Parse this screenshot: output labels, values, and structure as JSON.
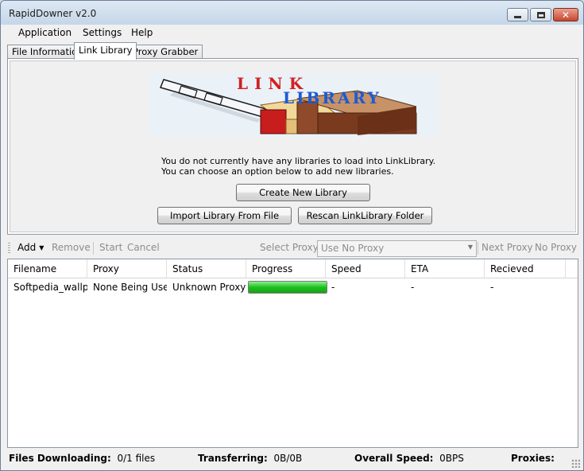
{
  "window": {
    "title": "RapidDowner v2.0"
  },
  "menu": {
    "items": [
      "Application",
      "Settings",
      "Help"
    ]
  },
  "tabs": [
    "File Information",
    "Link Library",
    "Proxy Grabber"
  ],
  "link_library": {
    "logo_text_1": "LINK",
    "logo_text_2": "LIBRARY",
    "message": "You do not currently have any libraries to load into LinkLibrary. You can choose an option below to add new libraries.",
    "create_button": "Create New Library",
    "import_button": "Import Library From File",
    "rescan_button": "Rescan LinkLibrary Folder"
  },
  "toolbar": {
    "add": "Add",
    "remove": "Remove",
    "start": "Start",
    "cancel": "Cancel",
    "select_proxy_label": "Select Proxy:",
    "proxy_value": "Use No Proxy",
    "next_proxy": "Next Proxy",
    "no_proxy": "No Proxy"
  },
  "downloads": {
    "columns": [
      "Filename",
      "Proxy",
      "Status",
      "Progress",
      "Speed",
      "ETA",
      "Recieved"
    ],
    "rows": [
      {
        "filename": "Softpedia_wallpa...",
        "proxy": "None Being Used",
        "status": "Unknown Proxy ...",
        "progress": 1.0,
        "speed": "-",
        "eta": "-",
        "received": "-"
      }
    ]
  },
  "status": {
    "files_label": "Files Downloading:",
    "files_value": "0/1 files",
    "transfer_label": "Transferring:",
    "transfer_value": "0B/0B",
    "speed_label": "Overall Speed:",
    "speed_value": "0BPS",
    "proxies_label": "Proxies:"
  },
  "colors": {
    "progress_green": "#1fbf1f",
    "close_red": "#c9462d"
  }
}
